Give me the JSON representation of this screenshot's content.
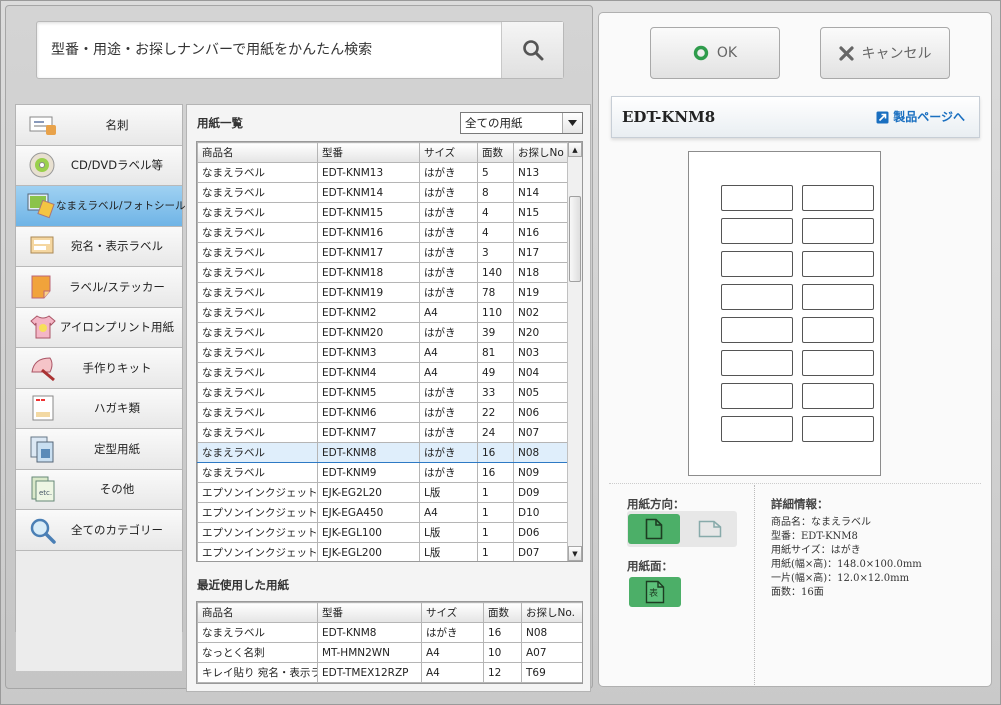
{
  "search": {
    "placeholder": "型番・用途・お探しナンバーで用紙をかんたん検索"
  },
  "categories": [
    {
      "label": "名刺",
      "icon": "business-card-icon"
    },
    {
      "label": "CD/DVDラベル等",
      "icon": "cd-dvd-icon"
    },
    {
      "label": "なまえラベル/フォトシール",
      "icon": "name-label-photo-sticker-icon"
    },
    {
      "label": "宛名・表示ラベル",
      "icon": "address-label-icon"
    },
    {
      "label": "ラベル/ステッカー",
      "icon": "sticker-icon"
    },
    {
      "label": "アイロンプリント用紙",
      "icon": "iron-print-shirt-icon"
    },
    {
      "label": "手作りキット",
      "icon": "craft-kit-fan-icon"
    },
    {
      "label": "ハガキ類",
      "icon": "postcard-icon"
    },
    {
      "label": "定型用紙",
      "icon": "standard-paper-icon"
    },
    {
      "label": "その他",
      "icon": "other-etc-icon"
    },
    {
      "label": "全てのカテゴリー",
      "icon": "magnifier-icon"
    }
  ],
  "paper_list": {
    "title": "用紙一覧",
    "filter": "全ての用紙",
    "headers": [
      "商品名",
      "型番",
      "サイズ",
      "面数",
      "お探しNo"
    ],
    "rows": [
      [
        "なまえラベル",
        "EDT-KNM13",
        "はがき",
        "5",
        "N13"
      ],
      [
        "なまえラベル",
        "EDT-KNM14",
        "はがき",
        "8",
        "N14"
      ],
      [
        "なまえラベル",
        "EDT-KNM15",
        "はがき",
        "4",
        "N15"
      ],
      [
        "なまえラベル",
        "EDT-KNM16",
        "はがき",
        "4",
        "N16"
      ],
      [
        "なまえラベル",
        "EDT-KNM17",
        "はがき",
        "3",
        "N17"
      ],
      [
        "なまえラベル",
        "EDT-KNM18",
        "はがき",
        "140",
        "N18"
      ],
      [
        "なまえラベル",
        "EDT-KNM19",
        "はがき",
        "78",
        "N19"
      ],
      [
        "なまえラベル",
        "EDT-KNM2",
        "A4",
        "110",
        "N02"
      ],
      [
        "なまえラベル",
        "EDT-KNM20",
        "はがき",
        "39",
        "N20"
      ],
      [
        "なまえラベル",
        "EDT-KNM3",
        "A4",
        "81",
        "N03"
      ],
      [
        "なまえラベル",
        "EDT-KNM4",
        "A4",
        "49",
        "N04"
      ],
      [
        "なまえラベル",
        "EDT-KNM5",
        "はがき",
        "33",
        "N05"
      ],
      [
        "なまえラベル",
        "EDT-KNM6",
        "はがき",
        "22",
        "N06"
      ],
      [
        "なまえラベル",
        "EDT-KNM7",
        "はがき",
        "24",
        "N07"
      ],
      [
        "なまえラベル",
        "EDT-KNM8",
        "はがき",
        "16",
        "N08"
      ],
      [
        "なまえラベル",
        "EDT-KNM9",
        "はがき",
        "16",
        "N09"
      ],
      [
        "エプソンインクジェット用",
        "EJK-EG2L20",
        "L版",
        "1",
        "D09"
      ],
      [
        "エプソンインクジェット用",
        "EJK-EGA450",
        "A4",
        "1",
        "D10"
      ],
      [
        "エプソンインクジェット用",
        "EJK-EGL100",
        "L版",
        "1",
        "D06"
      ],
      [
        "エプソンインクジェット用",
        "EJK-EGL200",
        "L版",
        "1",
        "D07"
      ]
    ],
    "selected_index": 14
  },
  "recent": {
    "title": "最近使用した用紙",
    "headers": [
      "商品名",
      "型番",
      "サイズ",
      "面数",
      "お探しNo."
    ],
    "rows": [
      [
        "なまえラベル",
        "EDT-KNM8",
        "はがき",
        "16",
        "N08"
      ],
      [
        "なっとく名刺",
        "MT-HMN2WN",
        "A4",
        "10",
        "A07"
      ],
      [
        "キレイ貼り 宛名・表示ラベル",
        "EDT-TMEX12RZP",
        "A4",
        "12",
        "T69"
      ]
    ]
  },
  "actions": {
    "ok": "OK",
    "cancel": "キャンセル"
  },
  "detail": {
    "code": "EDT-KNM8",
    "product_link": "製品ページへ",
    "orientation_label": "用紙方向：",
    "face_label": "用紙面：",
    "face_glyph": "表",
    "info_title": "詳細情報：",
    "info_lines": [
      "商品名：なまえラベル",
      "型番：EDT-KNM8",
      "用紙サイズ：はがき",
      "用紙(幅×高)：148.0×100.0mm",
      "一片(幅×高)：12.0×12.0mm",
      "面数：16面"
    ],
    "label_count": 16
  },
  "colors": {
    "accent_green": "#4caf68",
    "selected_category": "#7dbcea",
    "link_blue": "#1a6fc0"
  }
}
